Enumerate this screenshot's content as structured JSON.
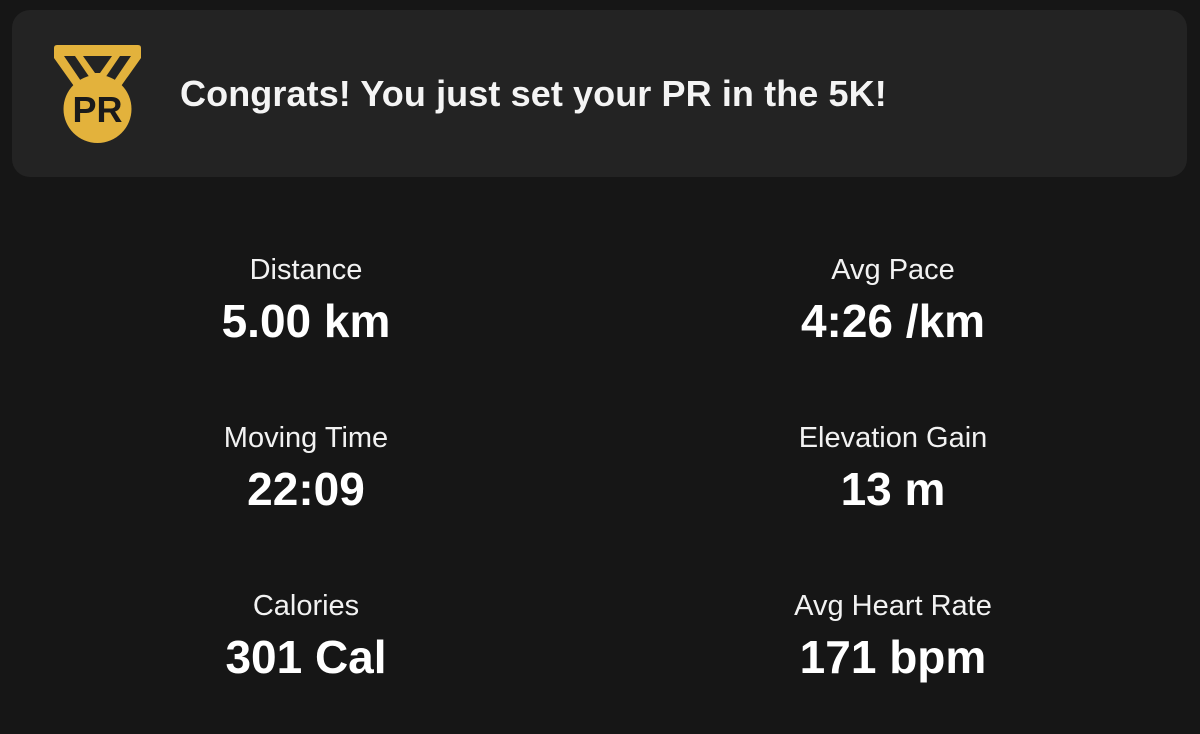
{
  "banner": {
    "message": "Congrats! You just set your PR in the 5K!",
    "badge_text": "PR",
    "badge_icon": "pr-medal-icon",
    "badge_color": "#e3b23c"
  },
  "stats": {
    "distance": {
      "label": "Distance",
      "value": "5.00 km"
    },
    "avg_pace": {
      "label": "Avg Pace",
      "value": "4:26 /km"
    },
    "moving_time": {
      "label": "Moving Time",
      "value": "22:09"
    },
    "elevation_gain": {
      "label": "Elevation Gain",
      "value": "13 m"
    },
    "calories": {
      "label": "Calories",
      "value": "301 Cal"
    },
    "avg_heart_rate": {
      "label": "Avg Heart Rate",
      "value": "171 bpm"
    }
  },
  "colors": {
    "background": "#161616",
    "banner_background": "#232323",
    "text": "#ffffff"
  }
}
